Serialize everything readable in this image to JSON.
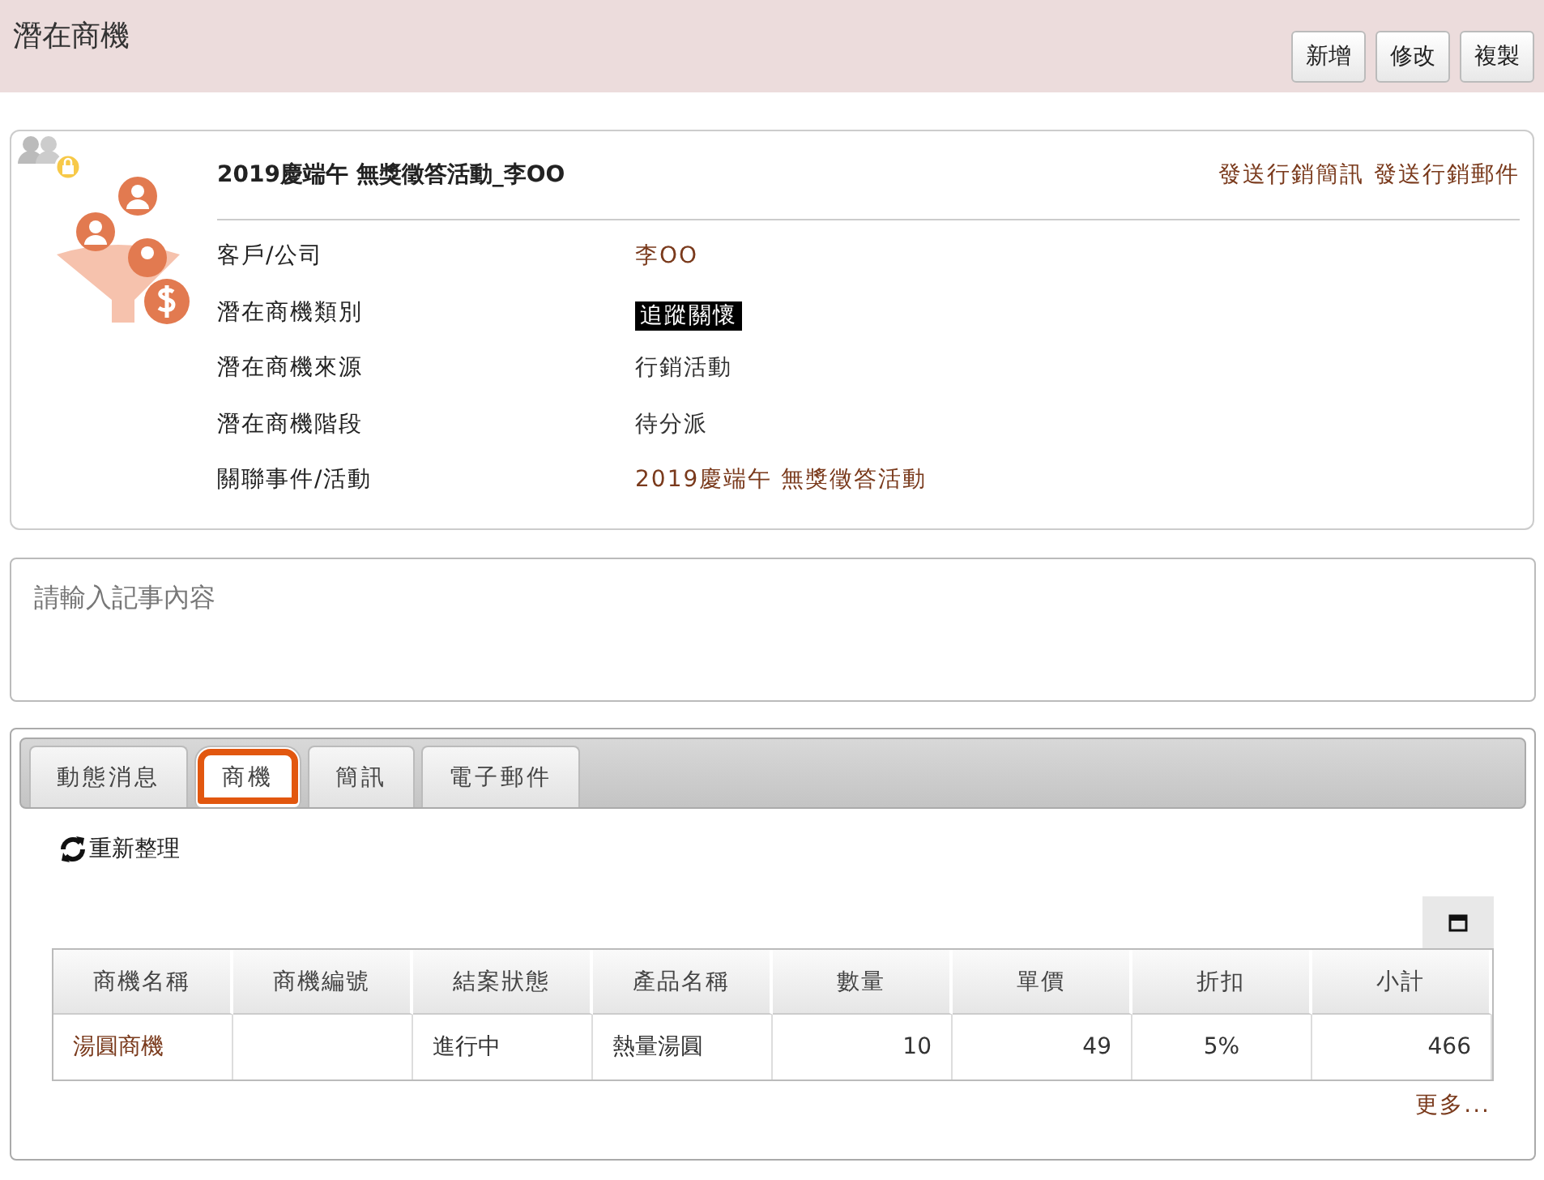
{
  "page_title": "潛在商機",
  "header_buttons": [
    "新增",
    "修改",
    "複製"
  ],
  "record": {
    "title": "2019慶端午 無獎徵答活動_李OO",
    "actions": [
      "發送行銷簡訊",
      "發送行銷郵件"
    ],
    "fields": [
      {
        "label": "客戶/公司",
        "value": "李OO",
        "kind": "link"
      },
      {
        "label": "潛在商機類別",
        "value": "追蹤關懷",
        "kind": "tag"
      },
      {
        "label": "潛在商機來源",
        "value": "行銷活動",
        "kind": "plain"
      },
      {
        "label": "潛在商機階段",
        "value": "待分派",
        "kind": "plain"
      },
      {
        "label": "關聯事件/活動",
        "value": "2019慶端午 無獎徵答活動",
        "kind": "link"
      }
    ]
  },
  "note": {
    "placeholder": "請輸入記事內容"
  },
  "tabs": [
    {
      "label": "動態消息",
      "selected": false,
      "highlighted": false
    },
    {
      "label": "商機",
      "selected": true,
      "highlighted": true
    },
    {
      "label": "簡訊",
      "selected": false,
      "highlighted": false
    },
    {
      "label": "電子郵件",
      "selected": false,
      "highlighted": false
    }
  ],
  "refresh_label": "重新整理",
  "table": {
    "columns": [
      {
        "label": "商機名稱",
        "kind": "text"
      },
      {
        "label": "商機編號",
        "kind": "text"
      },
      {
        "label": "結案狀態",
        "kind": "text"
      },
      {
        "label": "產品名稱",
        "kind": "text"
      },
      {
        "label": "數量",
        "kind": "number"
      },
      {
        "label": "單價",
        "kind": "number"
      },
      {
        "label": "折扣",
        "kind": "percent"
      },
      {
        "label": "小計",
        "kind": "number"
      }
    ],
    "rows": [
      {
        "cells": [
          {
            "text": "湯圓商機",
            "kind": "link"
          },
          {
            "kind": "empty"
          },
          {
            "text": "進行中",
            "kind": "text"
          },
          {
            "text": "熱量湯圓",
            "kind": "text"
          },
          {
            "text": "10",
            "kind": "text"
          },
          {
            "text": "49",
            "kind": "text"
          },
          {
            "text": "5%",
            "kind": "text"
          },
          {
            "text": "466",
            "kind": "text"
          }
        ]
      }
    ]
  },
  "more_link": "更多..."
}
